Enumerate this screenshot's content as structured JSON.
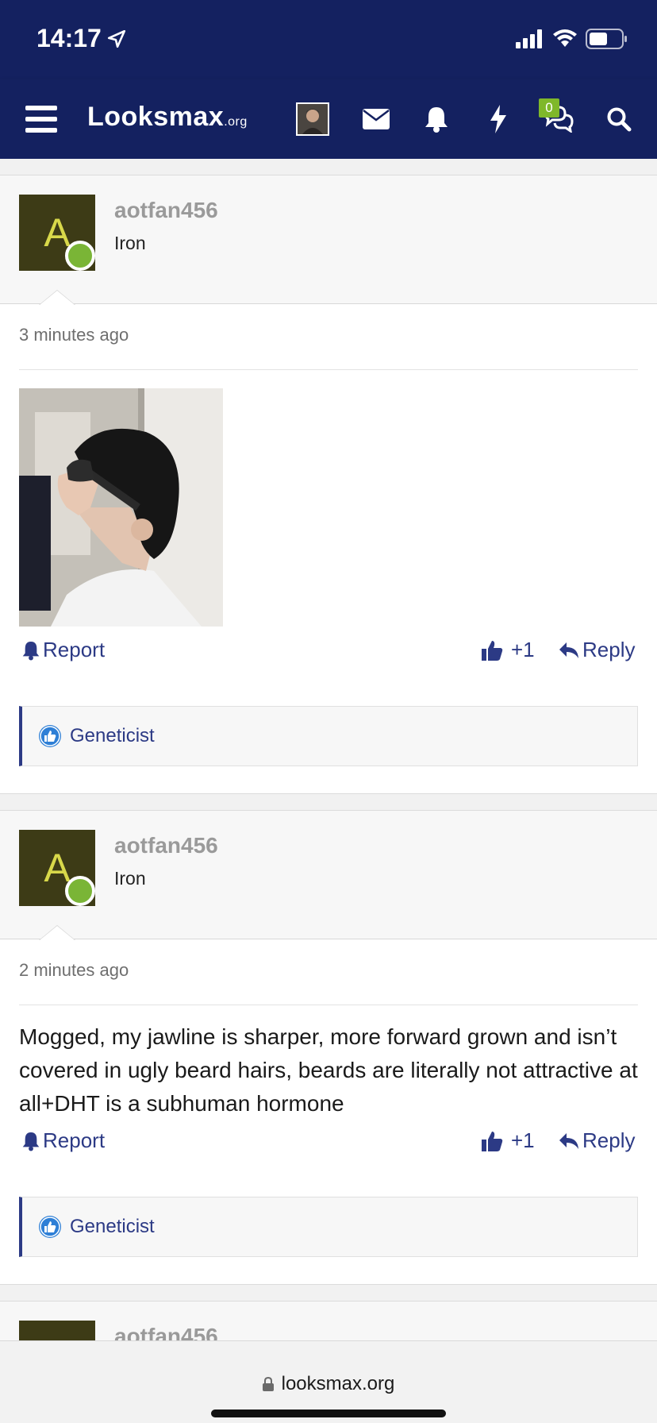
{
  "status_bar": {
    "time": "14:17"
  },
  "nav": {
    "logo_main": "Looksmax",
    "logo_suffix": ".org",
    "conversations_badge": "0"
  },
  "posts": [
    {
      "username": "aotfan456",
      "avatar_letter": "A",
      "rank": "Iron",
      "timestamp": "3 minutes ago",
      "report_label": "Report",
      "like_label": "+1",
      "reply_label": "Reply",
      "reaction_label": "Geneticist"
    },
    {
      "username": "aotfan456",
      "avatar_letter": "A",
      "rank": "Iron",
      "timestamp": "2 minutes ago",
      "text": "Mogged, my jawline is sharper, more forward grown and isn’t covered in ugly beard hairs, beards are literally not attractive at all+DHT is a subhuman hormone",
      "report_label": "Report",
      "like_label": "+1",
      "reply_label": "Reply",
      "reaction_label": "Geneticist"
    },
    {
      "username": "aotfan456"
    }
  ],
  "browser": {
    "url": "looksmax.org"
  },
  "colors": {
    "navbar": "#142160",
    "accent": "#2c3a85",
    "avatar_bg": "#3d3b16",
    "avatar_letter": "#d8d84a",
    "online": "#7ab536",
    "badge": "#7fb82a"
  },
  "icons": [
    "menu-icon",
    "envelope-icon",
    "bell-icon",
    "bolt-icon",
    "chat-icon",
    "search-icon",
    "lock-icon",
    "thumbs-up-icon",
    "reply-icon"
  ]
}
